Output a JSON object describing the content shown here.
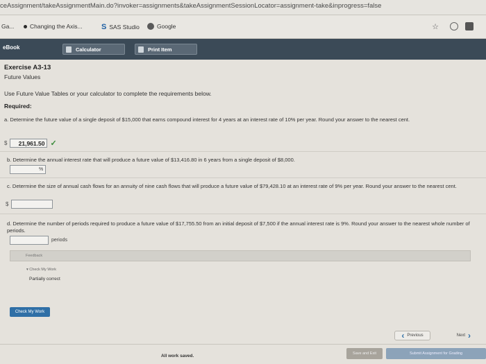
{
  "browser": {
    "url": "ceAssignment/takeAssignmentMain.do?invoker=assignments&takeAssignmentSessionLocator=assignment-take&inprogress=false",
    "bookmarks": [
      "Ga...",
      "Changing the Axis...",
      "SAS Studio",
      "Google"
    ]
  },
  "toolbar": {
    "ebook": "eBook",
    "calculator": "Calculator",
    "print_item": "Print Item"
  },
  "exercise": {
    "title": "Exercise A3-13",
    "subtitle": "Future Values",
    "instructions": "Use Future Value Tables or your calculator to complete the requirements below.",
    "required": "Required:"
  },
  "questions": [
    {
      "text": "a. Determine the future value of a single deposit of $15,000 that earns compound interest for 4 years at an interest rate of 10% per year. Round your answer to the nearest cent.",
      "prefix": "$",
      "value": "21,961.50",
      "unit": ""
    },
    {
      "text": "b. Determine the annual interest rate that will produce a future value of $13,416.80 in 6 years from a single deposit of $8,000.",
      "prefix": "",
      "value": "",
      "unit": "%"
    },
    {
      "text": "c. Determine the size of annual cash flows for an annuity of nine cash flows that will produce a future value of $79,428.10 at an interest rate of 9% per year. Round your answer to the nearest cent.",
      "prefix": "$",
      "value": "",
      "unit": ""
    },
    {
      "text": "d. Determine the number of periods required to produce a future value of $17,755.50 from an initial deposit of $7,500 if the annual interest rate is 9%. Round your answer to the nearest whole number of periods.",
      "prefix": "",
      "value": "",
      "unit": "periods"
    }
  ],
  "feedback": {
    "label": "Feedback",
    "check_my_work_small": "Check My Work",
    "status": "Partially correct"
  },
  "actions": {
    "check_my_work": "Check My Work",
    "previous": "Previous",
    "next": "Next",
    "saved": "All work saved.",
    "save_exit": "Save and Exit",
    "submit": "Submit Assignment for Grading"
  }
}
